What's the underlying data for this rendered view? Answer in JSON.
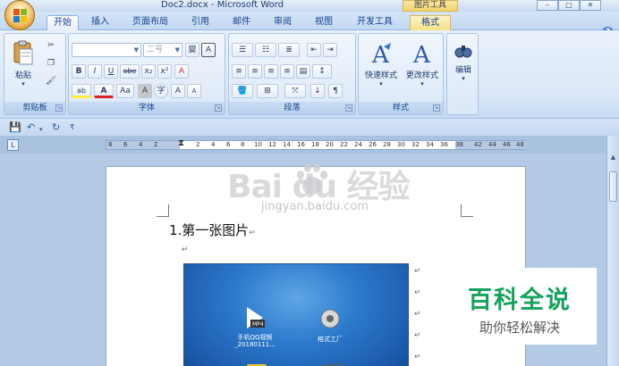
{
  "window": {
    "title": "Doc2.docx - Microsoft Word",
    "context_tool": "图片工具",
    "controls": {
      "minimize": "–",
      "restore": "□",
      "close": "✕"
    }
  },
  "tabs": [
    {
      "label": "开始",
      "active": true
    },
    {
      "label": "插入"
    },
    {
      "label": "页面布局"
    },
    {
      "label": "引用"
    },
    {
      "label": "邮件"
    },
    {
      "label": "审阅"
    },
    {
      "label": "视图"
    },
    {
      "label": "开发工具"
    },
    {
      "label": "格式",
      "contextual": true
    }
  ],
  "ribbon": {
    "clipboard": {
      "label": "剪贴板",
      "paste": "粘贴",
      "cut_icon": "scissors-icon",
      "copy_icon": "copy-icon",
      "format_painter_icon": "brush-icon"
    },
    "font": {
      "label": "字体",
      "font_name": "",
      "font_size": "二号",
      "phonetic": "變",
      "border_char": "A",
      "bold": "B",
      "italic": "I",
      "underline": "U",
      "strike": "abe",
      "subscript": "x₂",
      "superscript": "x²",
      "clear_format": "A",
      "highlight": "ab",
      "font_color": "A",
      "change_case": "Aa",
      "char_shading": "A",
      "enclose": "字",
      "grow": "A",
      "shrink": "A"
    },
    "paragraph": {
      "label": "段落"
    },
    "styles": {
      "label": "样式",
      "quick_styles": "快速样式",
      "change_styles": "更改样式"
    },
    "editing": {
      "label": "编辑"
    }
  },
  "ruler": {
    "left_numbers": [
      "8",
      "6",
      "4",
      "2"
    ],
    "right_numbers": [
      "2",
      "4",
      "6",
      "8",
      "10",
      "12",
      "14",
      "16",
      "18",
      "20",
      "22",
      "24",
      "26",
      "28",
      "30",
      "32",
      "34",
      "36",
      "38",
      "42",
      "44",
      "46",
      "48"
    ]
  },
  "document": {
    "line1": "1.第一张图片",
    "para_mark": "↵",
    "desktop_icons": [
      {
        "label": "手机QQ视频_20180111..."
      },
      {
        "label": "格式工厂"
      }
    ]
  },
  "watermark": {
    "brand": "Bai du 经验",
    "url": "jingyan.baidu.com"
  },
  "badge": {
    "title": "百科全说",
    "subtitle": "助你轻松解决"
  },
  "colors": {
    "ribbon_text": "#15428b",
    "badge_green": "#15a25a",
    "office_orange": "#e8a53a"
  }
}
